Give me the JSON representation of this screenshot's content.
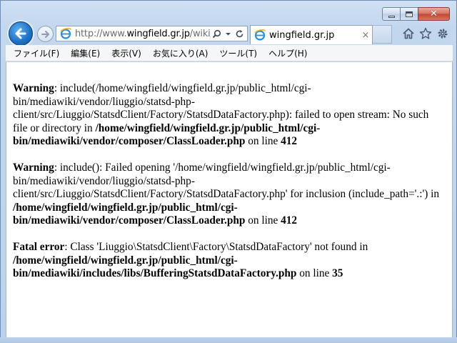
{
  "window": {
    "caption_close_glyph": "✕"
  },
  "address_bar": {
    "url_prefix": "http://www.",
    "url_host": "wingfield.gr.jp",
    "url_rest": "/wiki/"
  },
  "tab": {
    "title": "wingfield.gr.jp",
    "close_glyph": "×"
  },
  "menu": {
    "items": [
      "ファイル(F)",
      "編集(E)",
      "表示(V)",
      "お気に入り(A)",
      "ツール(T)",
      "ヘルプ(H)"
    ]
  },
  "errors": [
    {
      "label": "Warning",
      "message": ": include(/home/wingfield/wingfield.gr.jp/public_html/cgi-bin/mediawiki/vendor/liuggio/statsd-php-client/src/Liuggio/StatsdClient/Factory/StatsdDataFactory.php): failed to open stream: No such file or directory in ",
      "file": "/home/wingfield/wingfield.gr.jp/public_html/cgi-bin/mediawiki/vendor/composer/ClassLoader.php",
      "line_word": " on line ",
      "line": "412"
    },
    {
      "label": "Warning",
      "message": ": include(): Failed opening '/home/wingfield/wingfield.gr.jp/public_html/cgi-bin/mediawiki/vendor/liuggio/statsd-php-client/src/Liuggio/StatsdClient/Factory/StatsdDataFactory.php' for inclusion (include_path='.:') in ",
      "file": "/home/wingfield/wingfield.gr.jp/public_html/cgi-bin/mediawiki/vendor/composer/ClassLoader.php",
      "line_word": " on line ",
      "line": "412"
    },
    {
      "label": "Fatal error",
      "message": ": Class 'Liuggio\\StatsdClient\\Factory\\StatsdDataFactory' not found in ",
      "file": "/home/wingfield/wingfield.gr.jp/public_html/cgi-bin/mediawiki/includes/libs/BufferingStatsdDataFactory.php",
      "line_word": " on line ",
      "line": "35"
    }
  ],
  "icons": {
    "back": "back-arrow-icon",
    "forward": "forward-arrow-icon",
    "page": "internet-explorer-page-icon",
    "search": "search-icon",
    "dropdown": "dropdown-icon",
    "refresh": "refresh-icon",
    "home": "home-icon",
    "favorites": "favorites-star-icon",
    "tools": "gear-icon"
  },
  "colors": {
    "frame": "#bcd2ec",
    "back_button": "#1d6fc4",
    "close_button": "#c2452f"
  }
}
